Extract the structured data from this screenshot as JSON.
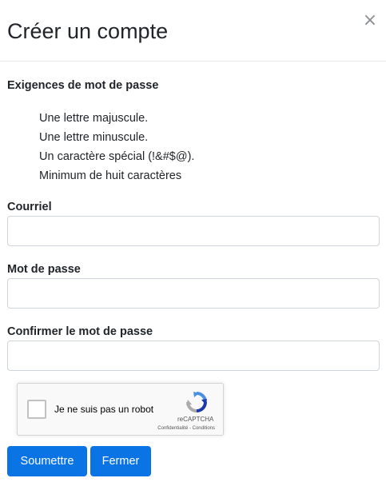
{
  "modal": {
    "title": "Créer un compte",
    "close_symbol": "×"
  },
  "requirements": {
    "heading": "Exigences de mot de passe",
    "items": [
      "Une lettre majuscule.",
      "Une lettre minuscule.",
      "Un caractère spécial (!&#$@).",
      "Minimum de huit caractères"
    ]
  },
  "form": {
    "email": {
      "label": "Courriel",
      "value": "",
      "placeholder": ""
    },
    "password": {
      "label": "Mot de passe",
      "value": "",
      "placeholder": ""
    },
    "confirm_password": {
      "label": "Confirmer le mot de passe",
      "value": "",
      "placeholder": ""
    }
  },
  "recaptcha": {
    "label": "Je ne suis pas un robot",
    "brand": "reCAPTCHA",
    "privacy": "Confidentialité - Conditions",
    "icon": "recaptcha-logo-icon"
  },
  "buttons": {
    "submit_label": "Soumettre",
    "close_label": "Fermer"
  },
  "colors": {
    "primary": "#0b74e5",
    "border": "#ced4da",
    "text": "#212529"
  }
}
